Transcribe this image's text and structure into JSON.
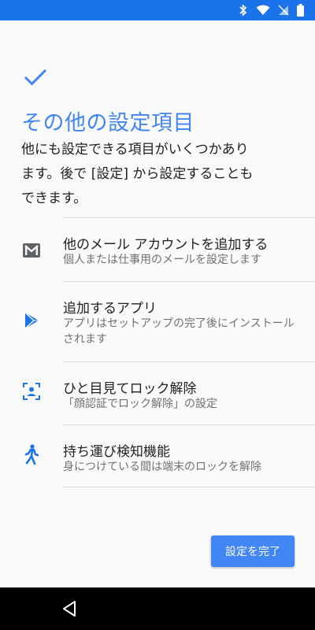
{
  "status_bar": {
    "icons": [
      "bluetooth-icon",
      "wifi-icon",
      "signal-icon",
      "battery-icon"
    ],
    "background": "#1a73e8"
  },
  "header": {
    "title": "その他の設定項目",
    "description": "他にも設定できる項目がいくつかあります。後で [設定] から設定することもできます。",
    "accent": "#4285f4"
  },
  "items": [
    {
      "icon": "gmail-icon",
      "title": "他のメール アカウントを追加する",
      "subtitle": "個人または仕事用のメールを設定します"
    },
    {
      "icon": "play-store-icon",
      "title": "追加するアプリ",
      "subtitle": "アプリはセットアップの完了後にインストールされます"
    },
    {
      "icon": "face-unlock-icon",
      "title": "ひと目見てロック解除",
      "subtitle": "「顔認証でロック解除」の設定"
    },
    {
      "icon": "walking-person-icon",
      "title": "持ち運び検知機能",
      "subtitle": "身につけている間は端末のロックを解除"
    }
  ],
  "footer": {
    "done_label": "設定を完了"
  },
  "nav_bar": {
    "icons": [
      "back-icon"
    ]
  }
}
